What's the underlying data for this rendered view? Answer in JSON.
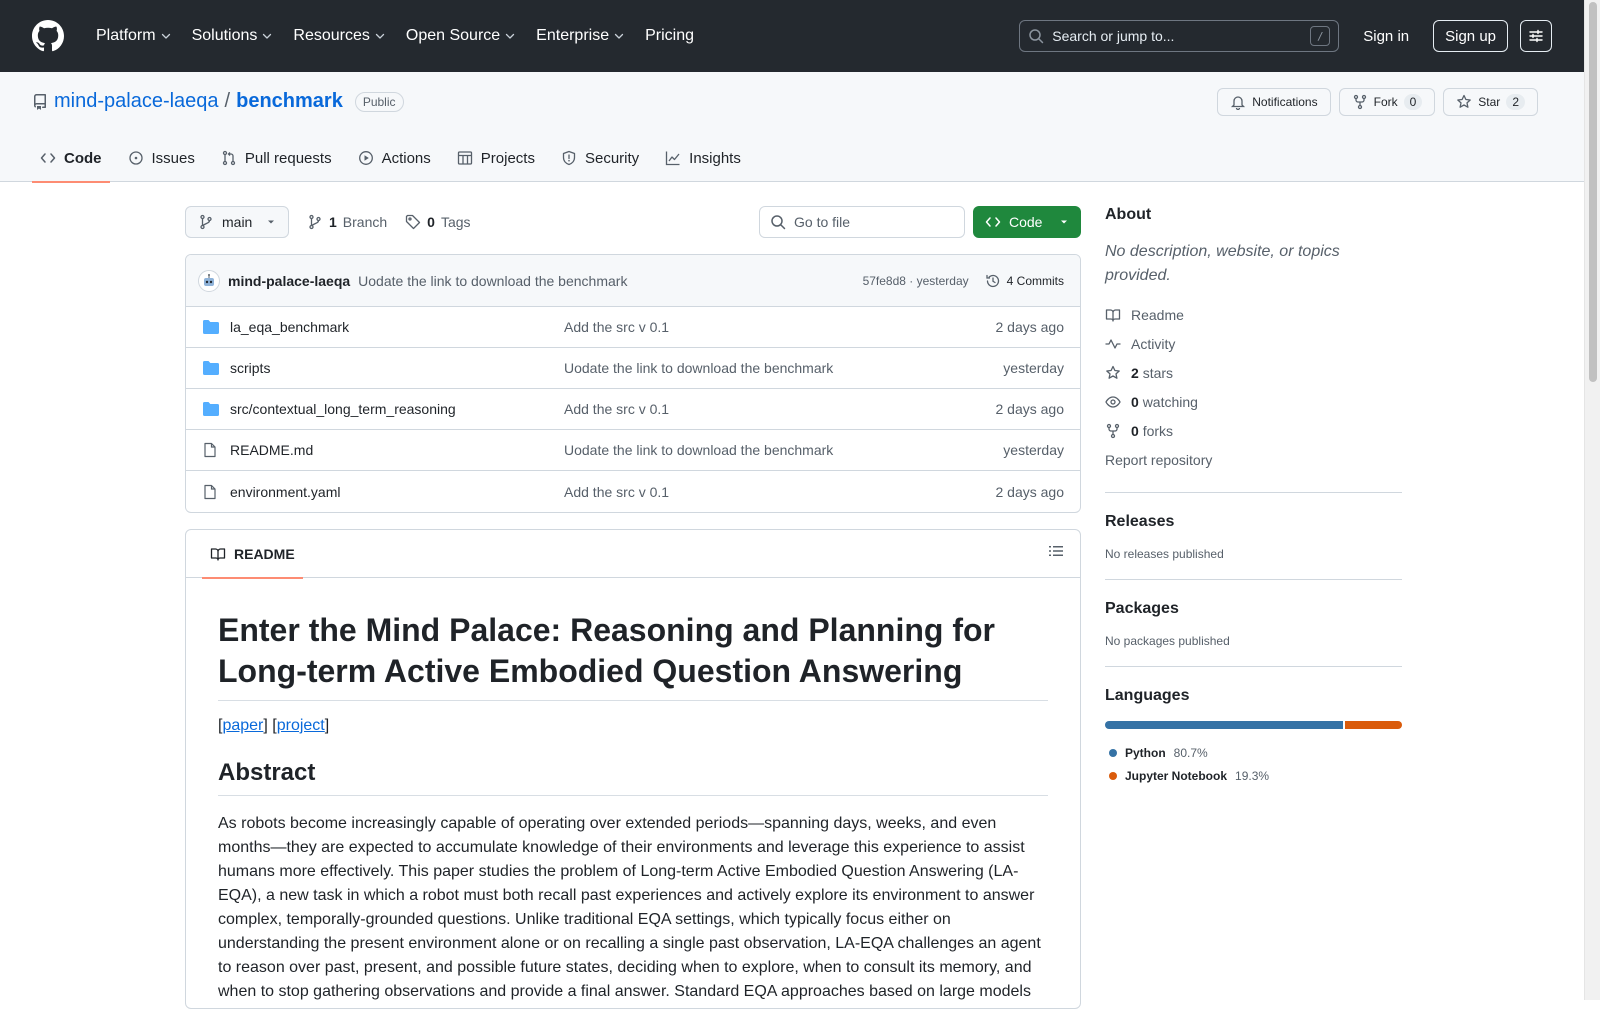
{
  "header": {
    "nav": [
      {
        "label": "Platform",
        "has_menu": true
      },
      {
        "label": "Solutions",
        "has_menu": true
      },
      {
        "label": "Resources",
        "has_menu": true
      },
      {
        "label": "Open Source",
        "has_menu": true
      },
      {
        "label": "Enterprise",
        "has_menu": true
      },
      {
        "label": "Pricing",
        "has_menu": false
      }
    ],
    "search_placeholder": "Search or jump to...",
    "search_key": "/",
    "sign_in": "Sign in",
    "sign_up": "Sign up"
  },
  "repo": {
    "owner": "mind-palace-laeqa",
    "separator": "/",
    "name": "benchmark",
    "visibility": "Public",
    "notifications_label": "Notifications",
    "fork_label": "Fork",
    "fork_count": "0",
    "star_label": "Star",
    "star_count": "2",
    "tabs": [
      {
        "label": "Code",
        "icon": "code-icon",
        "active": true
      },
      {
        "label": "Issues",
        "icon": "issue-icon",
        "active": false
      },
      {
        "label": "Pull requests",
        "icon": "pull-request-icon",
        "active": false
      },
      {
        "label": "Actions",
        "icon": "play-icon",
        "active": false
      },
      {
        "label": "Projects",
        "icon": "table-icon",
        "active": false
      },
      {
        "label": "Security",
        "icon": "shield-icon",
        "active": false
      },
      {
        "label": "Insights",
        "icon": "graph-icon",
        "active": false
      }
    ]
  },
  "toolbar": {
    "branch": "main",
    "branch_count": "1",
    "branch_label": "Branch",
    "tag_count": "0",
    "tag_label": "Tags",
    "goto_placeholder": "Go to file",
    "code_label": "Code"
  },
  "latest_commit": {
    "author": "mind-palace-laeqa",
    "message": "Uodate the link to download the benchmark",
    "hash_and_time": "57fe8d8 · yesterday",
    "commits_label": "4 Commits"
  },
  "files": [
    {
      "name": "la_eqa_benchmark",
      "type": "folder",
      "message": "Add the src v 0.1",
      "date": "2 days ago"
    },
    {
      "name": "scripts",
      "type": "folder",
      "message": "Uodate the link to download the benchmark",
      "date": "yesterday"
    },
    {
      "name": "src/contextual_long_term_reasoning",
      "type": "folder",
      "message": "Add the src v 0.1",
      "date": "2 days ago"
    },
    {
      "name": "README.md",
      "type": "file",
      "message": "Uodate the link to download the benchmark",
      "date": "yesterday"
    },
    {
      "name": "environment.yaml",
      "type": "file",
      "message": "Add the src v 0.1",
      "date": "2 days ago"
    }
  ],
  "readme": {
    "tab_label": "README",
    "title": "Enter the Mind Palace: Reasoning and Planning for Long-term Active Embodied Question Answering",
    "bracket_open": "[",
    "bracket_mid": "] [",
    "bracket_close": "]",
    "paper_link": "paper",
    "project_link": "project",
    "abstract_heading": "Abstract",
    "abstract_text": "As robots become increasingly capable of operating over extended periods—spanning days, weeks, and even months—they are expected to accumulate knowledge of their environments and leverage this experience to assist humans more effectively. This paper studies the problem of Long-term Active Embodied Question Answering (LA-EQA), a new task in which a robot must both recall past experiences and actively explore its environment to answer complex, temporally-grounded questions. Unlike traditional EQA settings, which typically focus either on understanding the present environment alone or on recalling a single past observation, LA-EQA challenges an agent to reason over past, present, and possible future states, deciding when to explore, when to consult its memory, and when to stop gathering observations and provide a final answer. Standard EQA approaches based on large models"
  },
  "sidebar": {
    "about_heading": "About",
    "about_desc": "No description, website, or topics provided.",
    "readme_link": "Readme",
    "activity_link": "Activity",
    "stars_count": "2",
    "stars_label": "stars",
    "watching_count": "0",
    "watching_label": "watching",
    "forks_count": "0",
    "forks_label": "forks",
    "report_link": "Report repository",
    "releases_heading": "Releases",
    "releases_text": "No releases published",
    "packages_heading": "Packages",
    "packages_text": "No packages published",
    "languages_heading": "Languages",
    "languages": [
      {
        "name": "Python",
        "percent": "80.7%",
        "value": 80.7,
        "color": "#3572A5"
      },
      {
        "name": "Jupyter Notebook",
        "percent": "19.3%",
        "value": 19.3,
        "color": "#DA5B0B"
      }
    ]
  },
  "colors": {
    "header_bg": "#24292f",
    "link": "#0969da",
    "primary_button": "#1f883d",
    "tab_underline": "#fd8c73",
    "folder": "#54aeff"
  }
}
